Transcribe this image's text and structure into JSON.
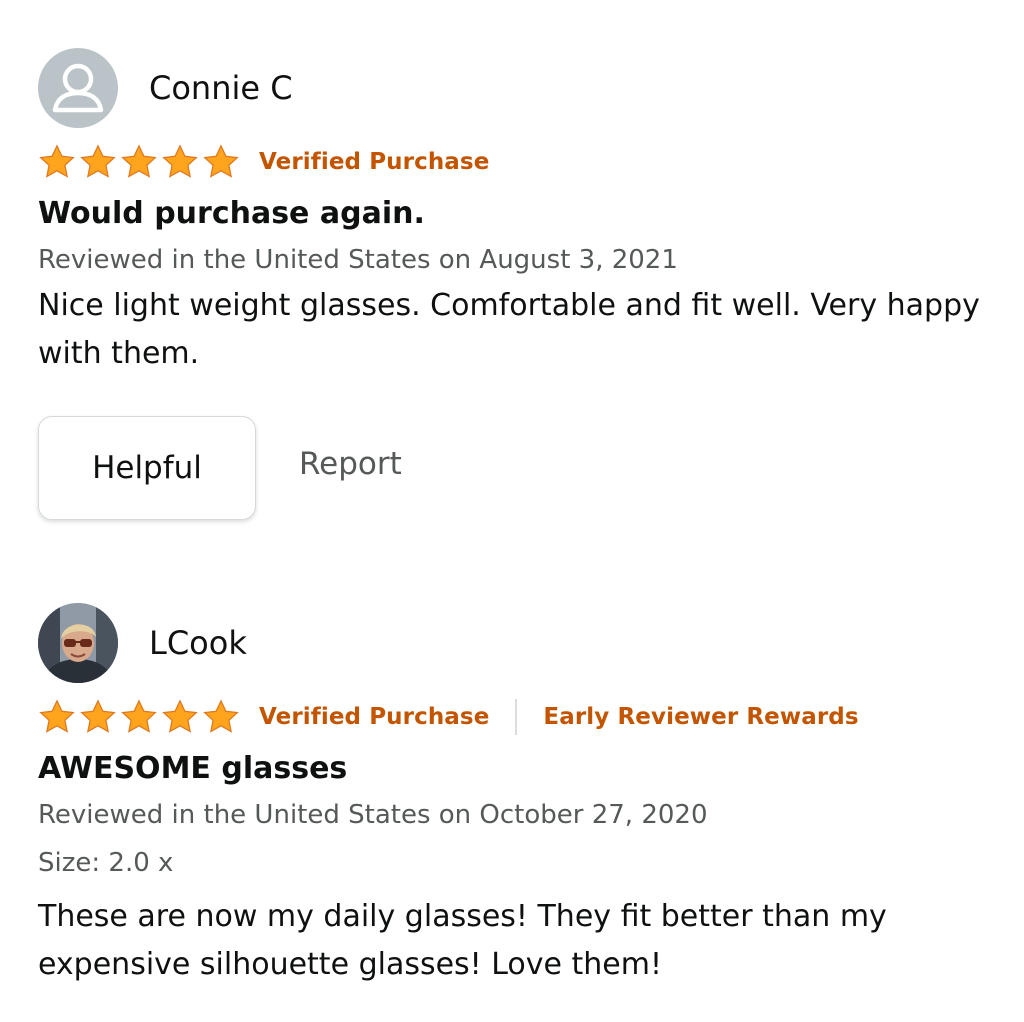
{
  "colors": {
    "star": "#ffa41c",
    "star_stroke": "#de7921",
    "badge": "#c45500",
    "meta_text": "#565959"
  },
  "reviews": [
    {
      "reviewer": "Connie C",
      "avatar_icon": "generic-person-icon",
      "rating": 5,
      "badges": [
        "Verified Purchase"
      ],
      "title": "Would purchase again.",
      "meta": "Reviewed in the United States on August 3, 2021",
      "body": "Nice light weight glasses. Comfortable and fit well. Very happy with them.",
      "helpful_label": "Helpful",
      "report_label": "Report"
    },
    {
      "reviewer": "LCook",
      "avatar_icon": "user-photo",
      "rating": 5,
      "badges": [
        "Verified Purchase",
        "Early Reviewer Rewards"
      ],
      "title": "AWESOME glasses",
      "meta": "Reviewed in the United States on October 27, 2020",
      "size": "Size: 2.0 x",
      "body": "These are now my daily glasses! They fit better than my expensive silhouette glasses! Love them!"
    }
  ]
}
